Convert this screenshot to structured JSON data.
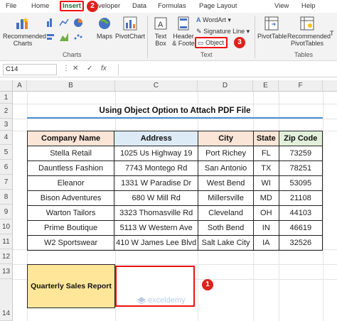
{
  "ribbon_tabs": {
    "file": "File",
    "home": "Home",
    "insert": "Insert",
    "developer": "veloper",
    "data": "Data",
    "formulas": "Formulas",
    "page_layout": "Page Layout",
    "view": "View",
    "help": "Help"
  },
  "badges": {
    "one": "1",
    "two": "2",
    "three": "3"
  },
  "ribbon": {
    "recommended_charts": [
      "Recommended",
      "Charts"
    ],
    "maps": "Maps",
    "pivotchart": "PivotChart",
    "charts_group": "Charts",
    "text_box": [
      "Text",
      "Box"
    ],
    "header_footer": [
      "Header",
      "& Foote"
    ],
    "wordart": "WordArt",
    "signature_line": "Signature Line",
    "object": "Object",
    "text_group": "Text",
    "pivottable": "PivotTable",
    "recommended_pivottables": [
      "Recommended",
      "PivotTables"
    ],
    "tables_group": "Tables",
    "tab_cutoff": "T"
  },
  "formula_bar": {
    "name_box": "C14",
    "fx": "fx",
    "content": ""
  },
  "columns": [
    "A",
    "B",
    "C",
    "D",
    "E",
    "F"
  ],
  "rows": [
    "1",
    "2",
    "3",
    "4",
    "5",
    "6",
    "7",
    "8",
    "9",
    "10",
    "11",
    "12",
    "13",
    "14"
  ],
  "sheet": {
    "title": "Using Object Option to Attach PDF File",
    "headers": [
      "Company Name",
      "Address",
      "City",
      "State",
      "Zip Code"
    ],
    "records": [
      [
        "Stella Retail",
        "1025 Us Highway 19",
        "Port Richey",
        "FL",
        "73259"
      ],
      [
        "Dauntless Fashion",
        "7743 Montego Rd",
        "San Antonio",
        "TX",
        "78251"
      ],
      [
        "Eleanor",
        "1331 W Paradise Dr",
        "West Bend",
        "WI",
        "53095"
      ],
      [
        "Bison Adventures",
        "680 W Mill Rd",
        "Millersville",
        "MD",
        "21108"
      ],
      [
        "Warton Tailors",
        "3323 Thomasville Rd",
        "Cleveland",
        "OH",
        "44103"
      ],
      [
        "Prime Boutique",
        "5113 W Western Ave",
        "Soth Bend",
        "IN",
        "46619"
      ],
      [
        "W2 Sportswear",
        "410 W James Lee Blvd",
        "Salt Lake City",
        "IA",
        "32526"
      ]
    ],
    "report_label": "Quarterly Sales Report"
  },
  "watermark": "exceldemy",
  "colors": {
    "accent_red": "#e0201b",
    "excel_green": "#1e6b3a",
    "header_orange": "#fbe5d6",
    "header_blue": "#ddebf7",
    "header_green": "#e2efda",
    "label_yellow": "#ffe699"
  }
}
